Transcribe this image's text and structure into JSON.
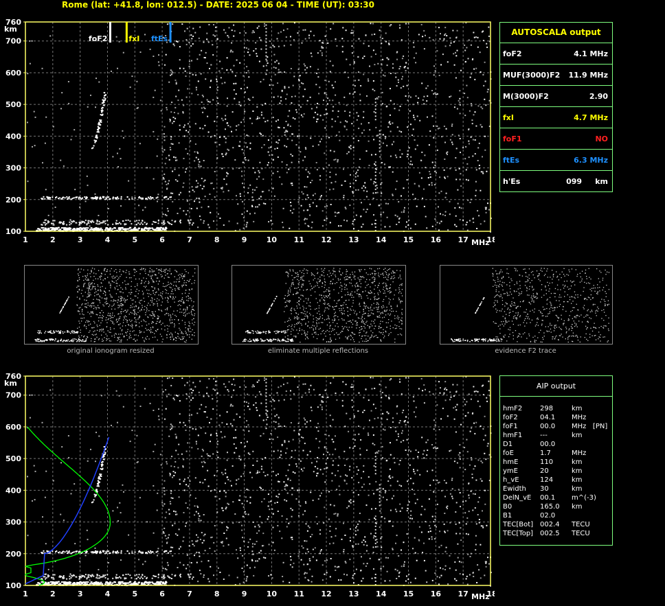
{
  "header": {
    "title": "Rome (lat: +41.8, lon: 012.5) - DATE: 2025 06 04 - TIME (UT): 03:30"
  },
  "axes": {
    "y_unit": "km",
    "x_unit": "MHz",
    "y_ticks": [
      "760",
      "700",
      "600",
      "500",
      "400",
      "300",
      "200",
      "100"
    ],
    "x_ticks": [
      "1",
      "2",
      "3",
      "4",
      "5",
      "6",
      "7",
      "8",
      "9",
      "10",
      "11",
      "12",
      "13",
      "14",
      "15",
      "16",
      "17",
      "18"
    ]
  },
  "markers": [
    {
      "label": "foF2",
      "freq": 4.1,
      "color": "#ffffff"
    },
    {
      "label": "fxI",
      "freq": 4.7,
      "color": "#ffff00"
    },
    {
      "label": "ftEs",
      "freq": 6.3,
      "color": "#1e90ff"
    }
  ],
  "autoscala": {
    "title": "AUTOSCALA output",
    "rows": [
      {
        "name": "foF2",
        "value": "4.1 MHz",
        "color": "#ffffff"
      },
      {
        "name": "MUF(3000)F2",
        "value": "11.9 MHz",
        "color": "#ffffff"
      },
      {
        "name": "M(3000)F2",
        "value": "2.90",
        "color": "#ffffff"
      },
      {
        "name": "fxI",
        "value": "4.7 MHz",
        "color": "#ffff00"
      },
      {
        "name": "foF1",
        "value": "NO",
        "color": "#ff2020"
      },
      {
        "name": "ftEs",
        "value": "6.3 MHz",
        "color": "#1e90ff"
      },
      {
        "name": "h'Es",
        "value": "099     km",
        "color": "#ffffff"
      }
    ]
  },
  "thumbnails": [
    {
      "caption": "original ionogram resized"
    },
    {
      "caption": "eliminate multiple reflections"
    },
    {
      "caption": "evidence F2 trace"
    }
  ],
  "aip": {
    "title": "AIP output",
    "rows": [
      {
        "name": "hmF2",
        "value": "298",
        "unit": "km"
      },
      {
        "name": "foF2",
        "value": "04.1",
        "unit": "MHz"
      },
      {
        "name": "foF1",
        "value": "00.0",
        "unit": "MHz   [PN]"
      },
      {
        "name": "hmF1",
        "value": "---",
        "unit": "km"
      },
      {
        "name": "D1",
        "value": "00.0",
        "unit": ""
      },
      {
        "name": "foE",
        "value": "1.7",
        "unit": "MHz"
      },
      {
        "name": "hmE",
        "value": "110",
        "unit": "km"
      },
      {
        "name": "ymE",
        "value": "20",
        "unit": "km"
      },
      {
        "name": "h_vE",
        "value": "124",
        "unit": "km"
      },
      {
        "name": "Ewidth",
        "value": "30",
        "unit": "km"
      },
      {
        "name": "DelN_vE",
        "value": "00.1",
        "unit": "m^(-3)"
      },
      {
        "name": "B0",
        "value": "165.0",
        "unit": "km"
      },
      {
        "name": "B1",
        "value": "02.0",
        "unit": ""
      },
      {
        "name": "TEC[Bot]",
        "value": "002.4",
        "unit": "TECU"
      },
      {
        "name": "TEC[Top]",
        "value": "002.5",
        "unit": "TECU"
      }
    ]
  },
  "colors": {
    "frame": "#ffff66",
    "grid": "#777777",
    "panel_border": "#7fff7f",
    "profile_green": "#00ff00",
    "profile_blue": "#2040ff"
  }
}
